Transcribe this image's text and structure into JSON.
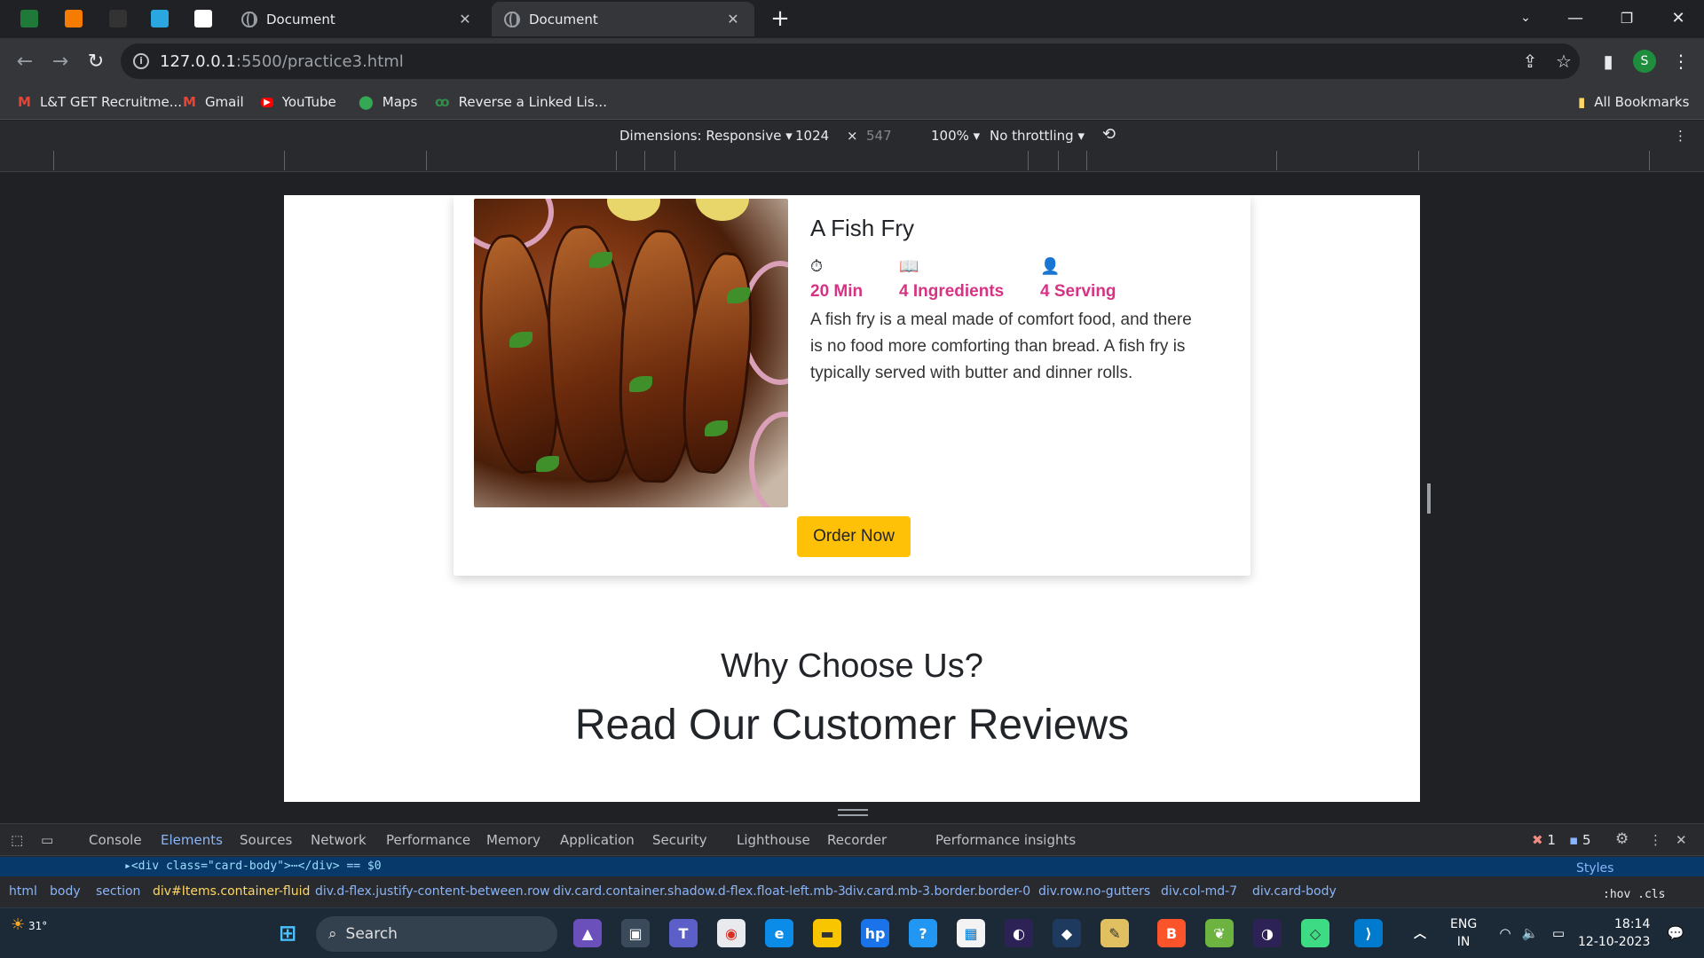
{
  "browser": {
    "tabs": [
      {
        "title": "Document",
        "active": false
      },
      {
        "title": "Document",
        "active": true
      }
    ],
    "new_tab": "+",
    "address": {
      "host": "127.0.0.1",
      "path": ":5500/practice3.html"
    },
    "profile_initial": "S",
    "bookmarks": [
      {
        "label": "L&T GET Recruitme...",
        "icon": "gmail-icon"
      },
      {
        "label": "Gmail",
        "icon": "gmail-icon"
      },
      {
        "label": "YouTube",
        "icon": "youtube-icon"
      },
      {
        "label": "Maps",
        "icon": "maps-icon"
      },
      {
        "label": "Reverse a Linked Lis...",
        "icon": "gfg-icon"
      }
    ],
    "all_bookmarks": "All Bookmarks"
  },
  "device_toolbar": {
    "dimensions": "Dimensions: Responsive",
    "width": "1024",
    "times": "×",
    "height": "547",
    "zoom": "100%",
    "throttling": "No throttling"
  },
  "page": {
    "card": {
      "title": "A Fish Fry",
      "stats": [
        {
          "icon": "history-icon",
          "label": "20 Min"
        },
        {
          "icon": "book-icon",
          "label": "4 Ingredients"
        },
        {
          "icon": "user-icon",
          "label": "4 Serving"
        }
      ],
      "description": "A fish fry is a meal made of comfort food, and there is no food more comforting than bread. A fish fry is typically served with butter and dinner rolls.",
      "button": "Order Now"
    },
    "why_heading": "Why Choose Us?",
    "reviews_heading": "Read Our Customer Reviews"
  },
  "devtools": {
    "tabs": [
      "Console",
      "Elements",
      "Sources",
      "Network",
      "Performance",
      "Memory",
      "Application",
      "Security",
      "Lighthouse",
      "Recorder",
      "Performance insights"
    ],
    "active_tab": "Elements",
    "errors": "1",
    "messages": "5",
    "dom_line": "▸<div class=\"card-body\">⋯</div> == $0",
    "breadcrumbs": [
      "html",
      "body",
      "section",
      "div#Items.container-fluid",
      "div.d-flex.justify-content-between.row",
      "div.card.container.shadow.d-flex.float-left.mb-3",
      "div.card.mb-3.border.border-0",
      "div.row.no-gutters",
      "div.col-md-7",
      "div.card-body"
    ],
    "styles_tab": "Styles",
    "hov_cls": ":hov .cls"
  },
  "taskbar": {
    "weather": "31°",
    "search": "Search",
    "lang_top": "ENG",
    "lang_bottom": "IN",
    "time": "18:14",
    "date": "12-10-2023"
  }
}
